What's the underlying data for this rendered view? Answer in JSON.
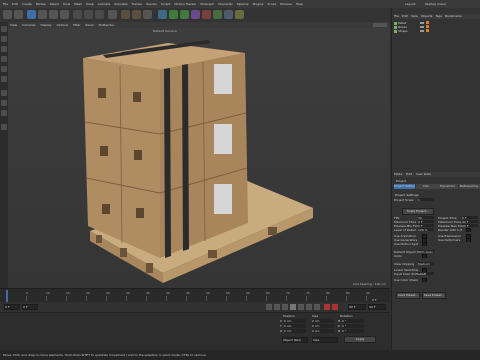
{
  "menubar": {
    "items": [
      "File",
      "Edit",
      "Create",
      "Modes",
      "Select",
      "Tools",
      "Mesh",
      "Snap",
      "Animate",
      "Simulate",
      "Tracker",
      "Render",
      "Sculpt",
      "Motion Tracker",
      "MoGraph",
      "Character",
      "Pipeline",
      "Plugins",
      "Script",
      "Window",
      "Help"
    ],
    "layout_label": "Layout:",
    "layout_value": "Startup (User)"
  },
  "viewport": {
    "menu": [
      "View",
      "Cameras",
      "Display",
      "Options",
      "Filter",
      "Panel",
      "ProRender"
    ],
    "camera_label": "Default Camera",
    "camera_icon": "camera-icon",
    "grid_spacing": "Grid Spacing : 100 cm"
  },
  "object_manager": {
    "menu": [
      "File",
      "Edit",
      "View",
      "Objects",
      "Tags",
      "Bookmarks"
    ],
    "objects": [
      {
        "name": "Pallet"
      },
      {
        "name": "Boxes"
      },
      {
        "name": "Straps"
      }
    ]
  },
  "attributes": {
    "menu": [
      "Mode",
      "Edit",
      "User Data"
    ],
    "header_label": "Project",
    "tabs": [
      "Project Settings",
      "Info",
      "Dynamics",
      "Referencing"
    ],
    "section_title": "Project Settings",
    "rows": [
      {
        "label": "Project Scale",
        "value": "1",
        "unit": "Centimeters"
      },
      {
        "label": "FPS",
        "value": "30"
      },
      {
        "label": "Project Time",
        "value": "0 F"
      },
      {
        "label": "Minimum Time",
        "value": "0 F"
      },
      {
        "label": "Maximum Time",
        "value": "90 F"
      },
      {
        "label": "Preview Min Time",
        "value": "0 F"
      },
      {
        "label": "Preview Max Time",
        "value": "90 F"
      },
      {
        "label": "Level of Detail",
        "value": "100 %"
      },
      {
        "label": "Render LOD in Editor",
        "value": ""
      },
      {
        "label": "Use Animation",
        "value": ""
      },
      {
        "label": "Use Expression",
        "value": ""
      },
      {
        "label": "Use Generators",
        "value": ""
      },
      {
        "label": "Use Deformers",
        "value": ""
      },
      {
        "label": "Use Motion System",
        "value": ""
      },
      {
        "label": "Default Object Color",
        "value": "80% Gray"
      },
      {
        "label": "Color",
        "value": ""
      },
      {
        "label": "View Clipping",
        "value": "Medium"
      },
      {
        "label": "Linear Workflow",
        "value": ""
      },
      {
        "label": "Input Color Profile",
        "value": "sRGB"
      },
      {
        "label": "Use Color Channel for Node Material",
        "value": ""
      }
    ],
    "scale_button": "Scale Project...",
    "bottom_buttons": [
      "Load Preset...",
      "Save Preset..."
    ]
  },
  "timeline": {
    "ticks": [
      "0",
      "5",
      "10",
      "15",
      "20",
      "25",
      "30",
      "35",
      "40",
      "45",
      "50",
      "55",
      "60",
      "65",
      "70",
      "75",
      "80",
      "85",
      "90"
    ],
    "end_frame": "0 F"
  },
  "transport": {
    "start": "0 F",
    "current": "0 F",
    "end": "90 F",
    "end2": "90 F"
  },
  "coordinates": {
    "headers": [
      "Position",
      "Size",
      "Rotation"
    ],
    "rows": [
      {
        "axis": "X",
        "pos": "0 cm",
        "size": "0 cm",
        "rot_axis": "H",
        "rot": "0 °"
      },
      {
        "axis": "Y",
        "pos": "0 cm",
        "size": "0 cm",
        "rot_axis": "P",
        "rot": "0 °"
      },
      {
        "axis": "Z",
        "pos": "0 cm",
        "size": "0 cm",
        "rot_axis": "B",
        "rot": "0 °"
      }
    ],
    "mode_left": "Object (Rel)",
    "mode_mid": "Size",
    "apply": "Apply"
  },
  "statusbar": {
    "text": "Move: Click and drag to move elements. Hold down SHIFT to quantize movement / add to the selection in point mode, CTRL to remove."
  },
  "colors": {
    "box": "#b08c63",
    "box_side": "#8f6f4b",
    "pallet": "#c9ab80",
    "strap": "#2b2b2b",
    "accent": "#3f6fa8",
    "active": "#d9802a"
  }
}
